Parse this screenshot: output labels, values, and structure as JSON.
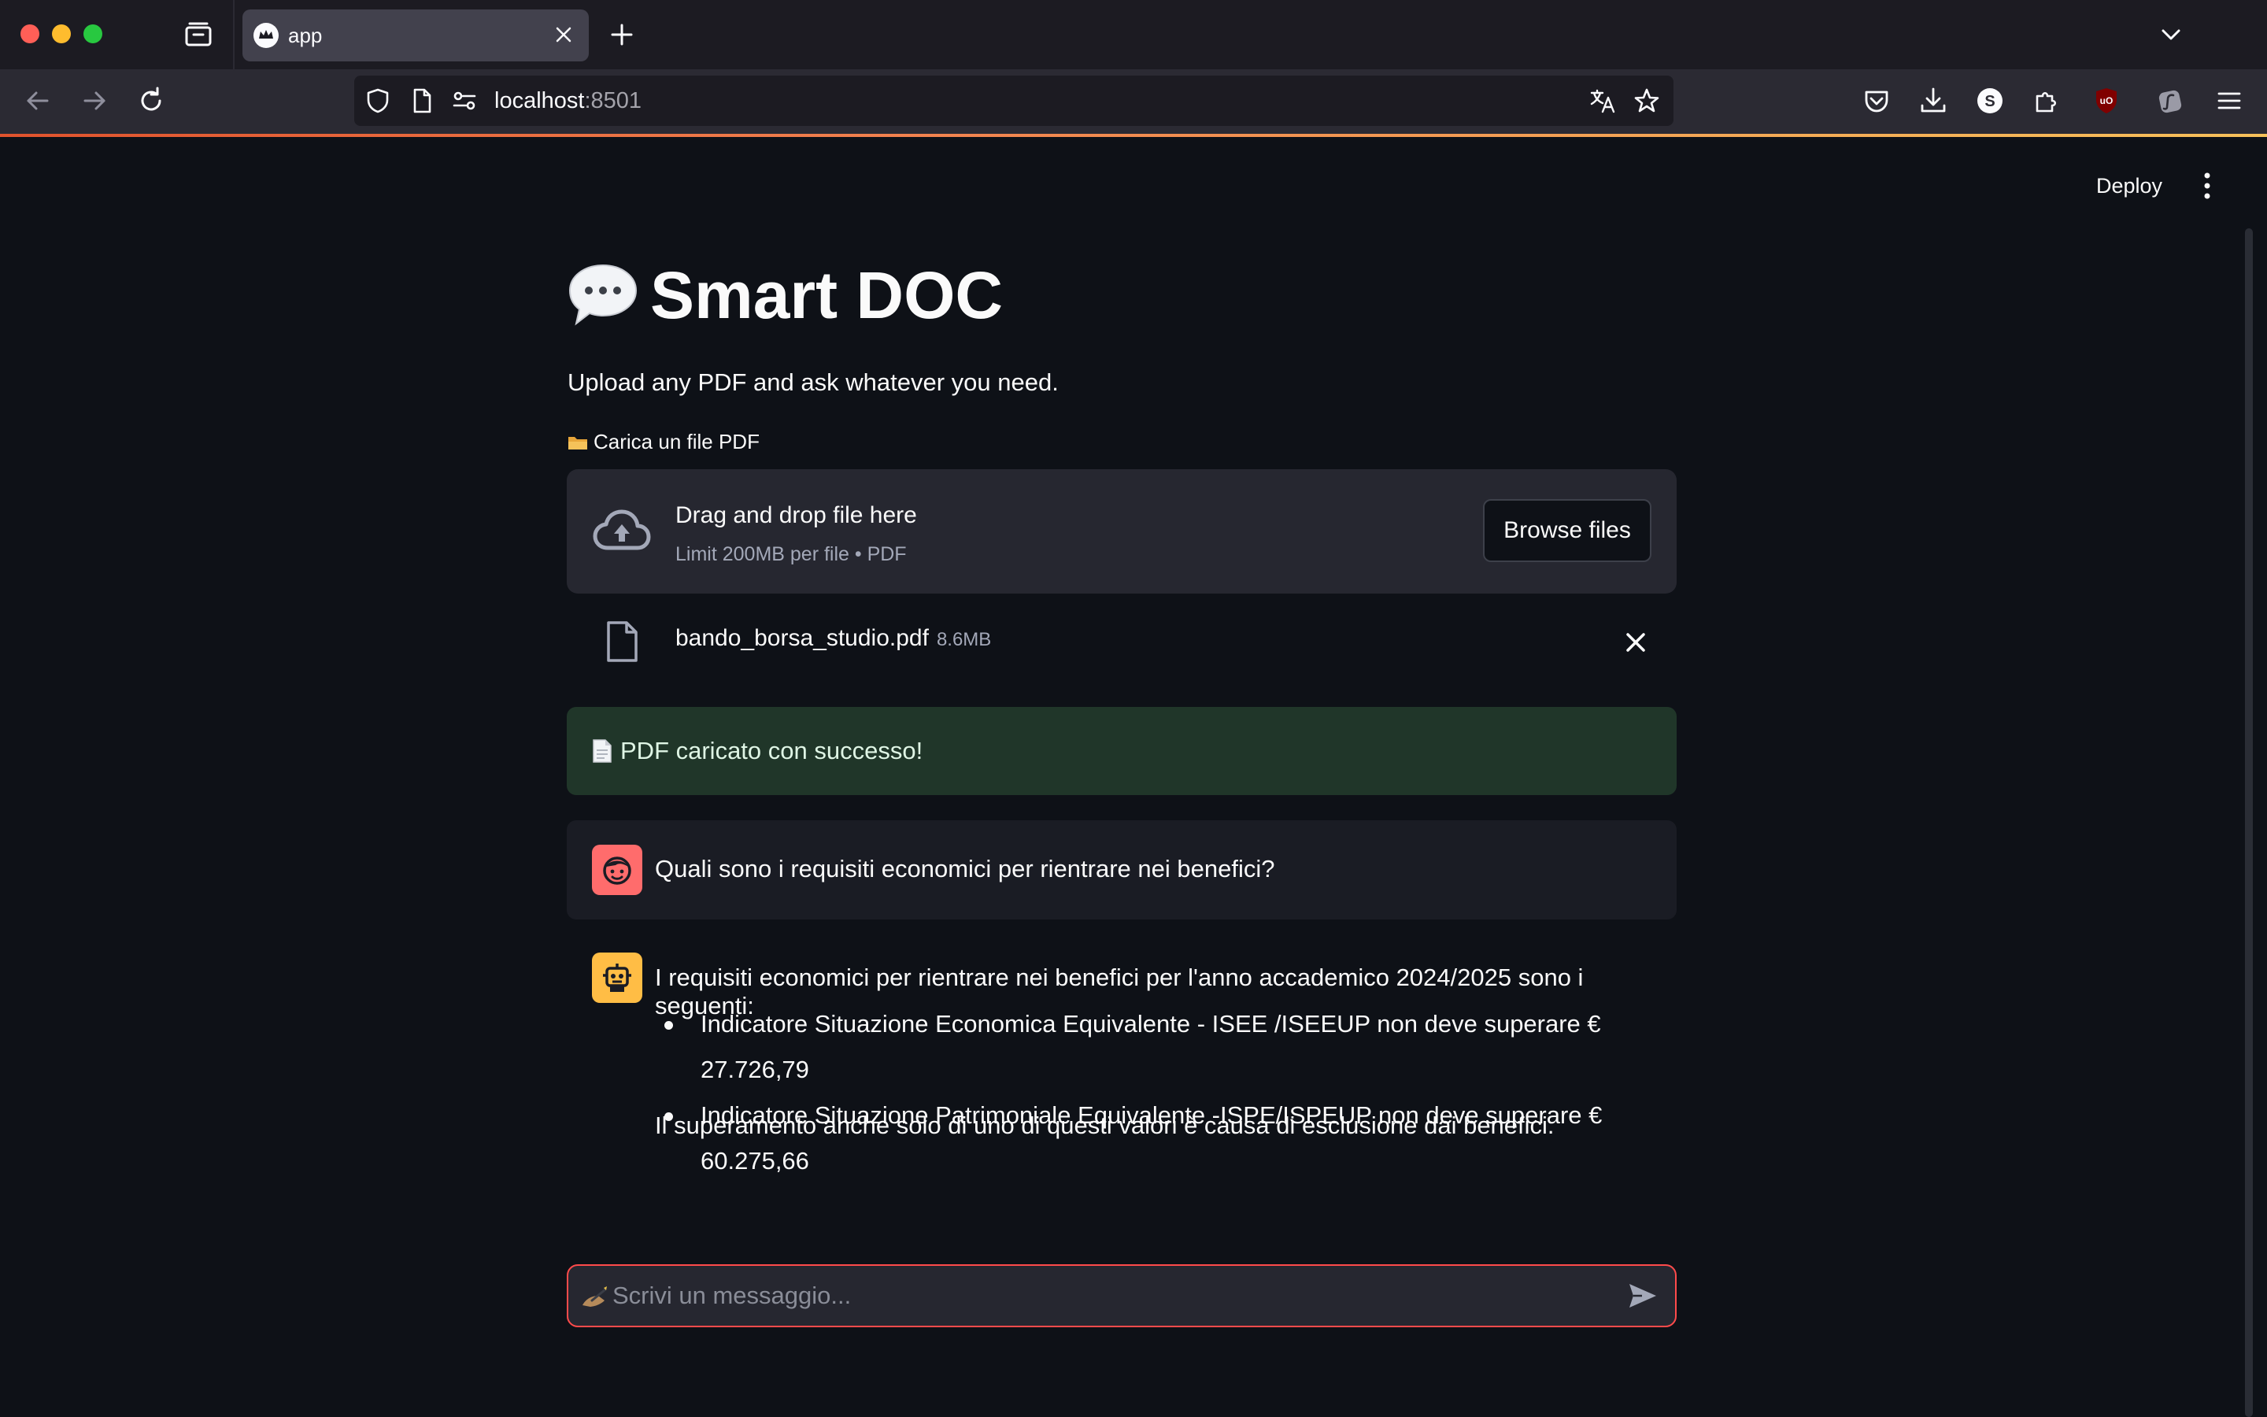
{
  "browser": {
    "tab_title": "app",
    "url_host": "localhost",
    "url_port": ":8501"
  },
  "header": {
    "deploy_label": "Deploy"
  },
  "main": {
    "title": "Smart DOC",
    "subtitle": "Upload any PDF and ask whatever you need.",
    "uploader": {
      "label": "Carica un file PDF",
      "drop_text": "Drag and drop file here",
      "limit_text": "Limit 200MB per file • PDF",
      "browse_label": "Browse files"
    },
    "file": {
      "name": "bando_borsa_studio.pdf",
      "size": "8.6MB"
    },
    "success_message": "PDF caricato con successo!",
    "messages": {
      "user": "Quali sono i requisiti economici per rientrare nei benefici?",
      "assistant_intro": "I requisiti economici per rientrare nei benefici per l'anno accademico 2024/2025 sono i seguenti:",
      "assistant_items": [
        "Indicatore Situazione Economica Equivalente - ISEE /ISEEUP non deve superare € 27.726,79",
        "Indicatore Situazione Patrimoniale Equivalente -ISPE/ISPEUP non deve superare € 60.275,66"
      ],
      "assistant_outro": "Il superamento anche solo di uno di questi valori è causa di esclusione dai benefici."
    },
    "chat_input": {
      "placeholder": "Scrivi un messaggio..."
    }
  },
  "colors": {
    "background": "#0e1117",
    "accent": "#ff4b4b",
    "success_bg": "#203629",
    "user_avatar": "#ff6c6c",
    "bot_avatar": "#ffbd45"
  }
}
